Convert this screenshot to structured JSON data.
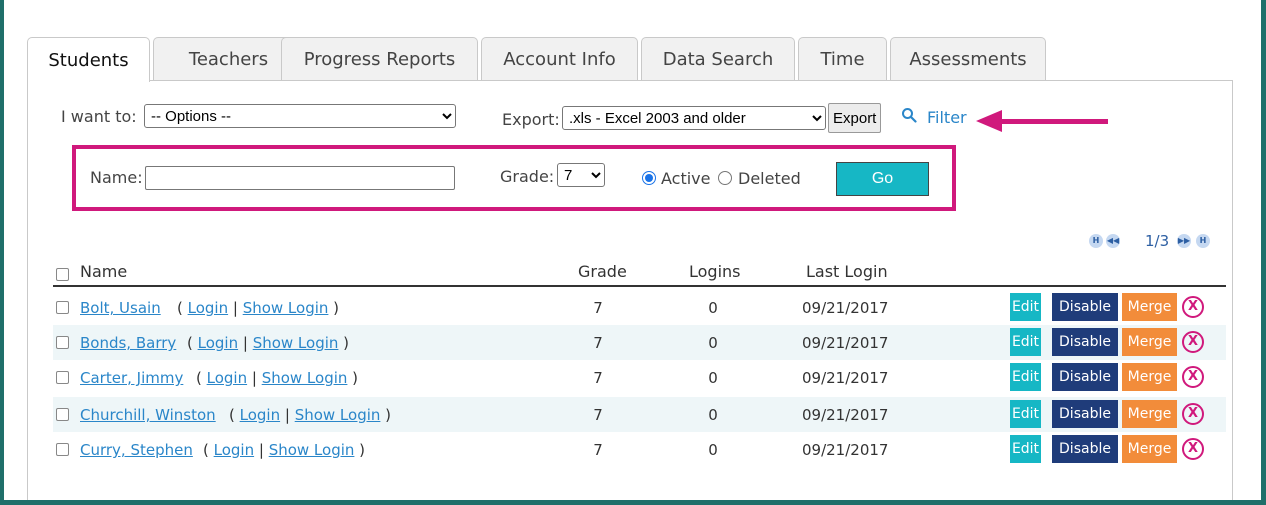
{
  "tabs": [
    "Students",
    "Teachers",
    "Progress Reports",
    "Account Info",
    "Data Search",
    "Time",
    "Assessments"
  ],
  "toolbar": {
    "i_want_to_label": "I want to:",
    "options_value": "-- Options --",
    "export_label": "Export:",
    "export_format": ".xls - Excel 2003 and older",
    "export_button": "Export",
    "filter_link": "Filter"
  },
  "filter": {
    "name_label": "Name:",
    "name_value": "",
    "grade_label": "Grade:",
    "grade_value": "7",
    "active_label": "Active",
    "deleted_label": "Deleted",
    "go_label": "Go"
  },
  "pager": {
    "text": "1/3",
    "first_icon": "H",
    "prev_icon": "◀◀",
    "next_icon": "▶▶",
    "last_icon": "H"
  },
  "table": {
    "columns": {
      "name": "Name",
      "grade": "Grade",
      "logins": "Logins",
      "last_login": "Last Login"
    },
    "login_label": "Login",
    "show_login_label": "Show Login",
    "actions": {
      "edit": "Edit",
      "disable": "Disable",
      "merge": "Merge",
      "delete": "X"
    },
    "rows": [
      {
        "name": "Bolt, Usain",
        "grade": "7",
        "logins": "0",
        "last_login": "09/21/2017"
      },
      {
        "name": "Bonds, Barry",
        "grade": "7",
        "logins": "0",
        "last_login": "09/21/2017"
      },
      {
        "name": "Carter, Jimmy",
        "grade": "7",
        "logins": "0",
        "last_login": "09/21/2017"
      },
      {
        "name": "Churchill, Winston",
        "grade": "7",
        "logins": "0",
        "last_login": "09/21/2017"
      },
      {
        "name": "Curry, Stephen",
        "grade": "7",
        "logins": "0",
        "last_login": "09/21/2017"
      }
    ]
  },
  "colors": {
    "frame": "#1f6f6a",
    "highlight": "#d0197c",
    "teal_button": "#16b7c5",
    "navy_button": "#1f3c7a",
    "orange_button": "#f28c3a",
    "link": "#2a86c9"
  }
}
